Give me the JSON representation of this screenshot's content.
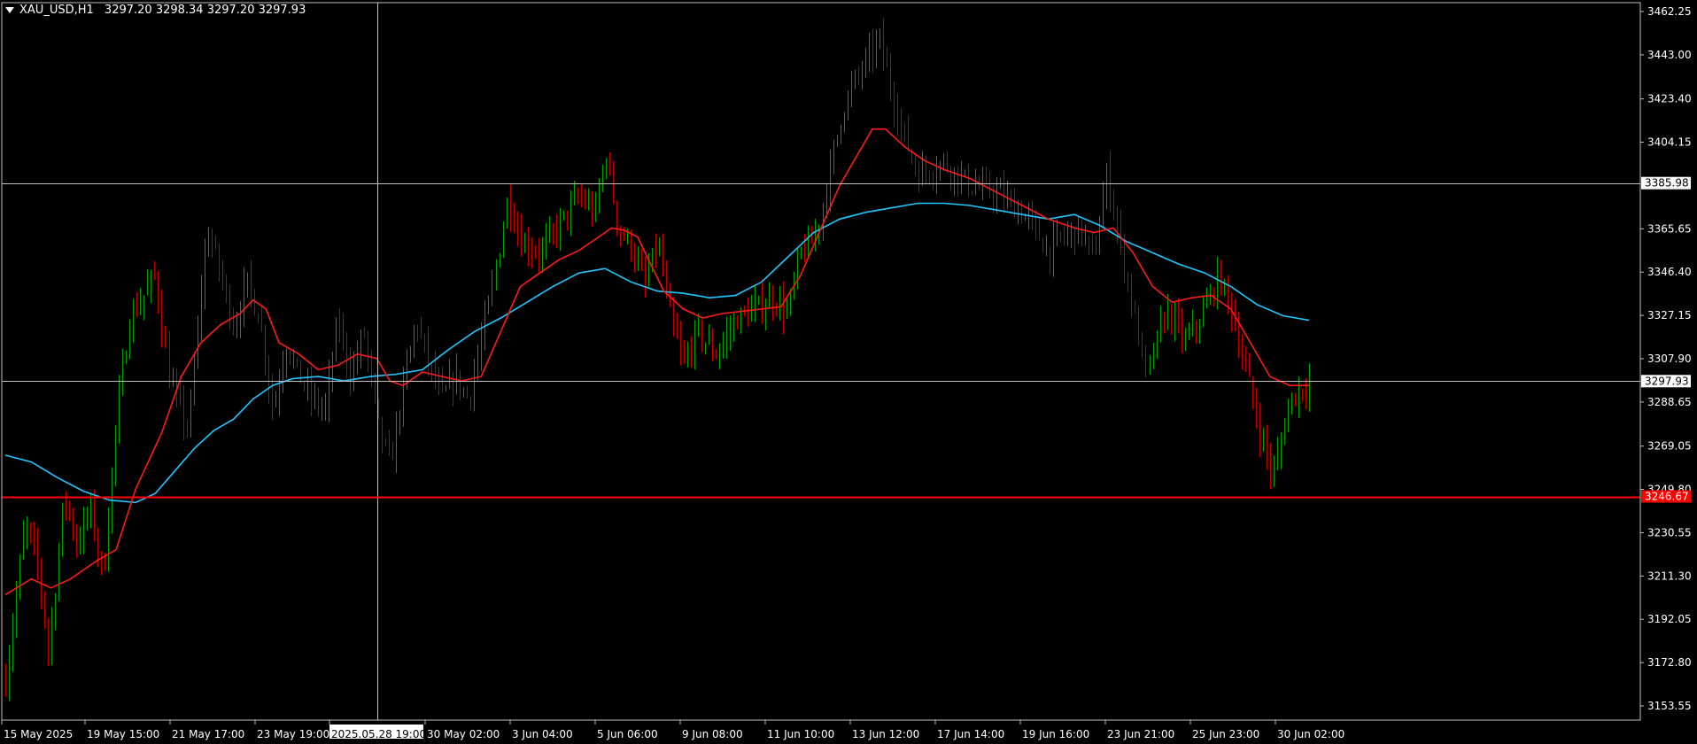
{
  "header": {
    "symbol": "XAU_USD,H1",
    "ohlc": "3297.20 3298.34 3297.20 3297.93"
  },
  "colors": {
    "background": "#000000",
    "frame": "#c0c0c0",
    "bull_bar": "#00a000",
    "bear_bar": "#c00000",
    "ma_fast": "#ff1a1a",
    "ma_slow": "#1ec8ff",
    "hline_red": "#ff0000",
    "hline_gray": "#c0c0c0",
    "crosshair": "#c0c0c0"
  },
  "chart_data": {
    "type": "candlestick",
    "y_ticks": [
      "3462.25",
      "3443.00",
      "3423.40",
      "3404.15",
      "3365.65",
      "3346.40",
      "3327.15",
      "3307.90",
      "3288.65",
      "3269.05",
      "3249.80",
      "3230.55",
      "3211.30",
      "3192.05",
      "3172.80",
      "3153.55"
    ],
    "price_markers": [
      {
        "label": "3385.98",
        "value": 3385.98,
        "style": "gray"
      },
      {
        "label": "3297.93",
        "value": 3297.93,
        "style": "gray"
      },
      {
        "label": "3246.67",
        "value": 3246.67,
        "style": "red"
      }
    ],
    "x_ticks": [
      "15 May 2025",
      "19 May 15:00",
      "21 May 17:00",
      "23 May 19:00",
      "2025.05.28 19:00",
      "30 May 02:00",
      "3 Jun 04:00",
      "5 Jun 06:00",
      "9 Jun 08:00",
      "11 Jun 10:00",
      "13 Jun 12:00",
      "17 Jun 14:00",
      "19 Jun 16:00",
      "23 Jun 21:00",
      "25 Jun 23:00",
      "30 Jun 02:00"
    ],
    "crosshair_label": "2025.05.28 19:00",
    "price_path": [
      [
        0,
        3165
      ],
      [
        0.015,
        3235
      ],
      [
        0.025,
        3215
      ],
      [
        0.033,
        3178
      ],
      [
        0.038,
        3205
      ],
      [
        0.045,
        3248
      ],
      [
        0.055,
        3225
      ],
      [
        0.065,
        3242
      ],
      [
        0.075,
        3210
      ],
      [
        0.085,
        3280
      ],
      [
        0.095,
        3325
      ],
      [
        0.115,
        3345
      ],
      [
        0.125,
        3300
      ],
      [
        0.14,
        3275
      ],
      [
        0.15,
        3340
      ],
      [
        0.155,
        3365
      ],
      [
        0.165,
        3345
      ],
      [
        0.175,
        3322
      ],
      [
        0.185,
        3342
      ],
      [
        0.195,
        3325
      ],
      [
        0.205,
        3285
      ],
      [
        0.215,
        3315
      ],
      [
        0.225,
        3300
      ],
      [
        0.235,
        3290
      ],
      [
        0.245,
        3285
      ],
      [
        0.255,
        3325
      ],
      [
        0.265,
        3300
      ],
      [
        0.275,
        3320
      ],
      [
        0.285,
        3280
      ],
      [
        0.295,
        3260
      ],
      [
        0.305,
        3295
      ],
      [
        0.315,
        3325
      ],
      [
        0.325,
        3305
      ],
      [
        0.335,
        3290
      ],
      [
        0.345,
        3300
      ],
      [
        0.355,
        3290
      ],
      [
        0.365,
        3315
      ],
      [
        0.375,
        3345
      ],
      [
        0.385,
        3380
      ],
      [
        0.395,
        3360
      ],
      [
        0.41,
        3355
      ],
      [
        0.425,
        3368
      ],
      [
        0.44,
        3380
      ],
      [
        0.452,
        3372
      ],
      [
        0.46,
        3400
      ],
      [
        0.47,
        3365
      ],
      [
        0.48,
        3358
      ],
      [
        0.49,
        3340
      ],
      [
        0.5,
        3360
      ],
      [
        0.51,
        3325
      ],
      [
        0.52,
        3305
      ],
      [
        0.53,
        3320
      ],
      [
        0.545,
        3310
      ],
      [
        0.56,
        3325
      ],
      [
        0.575,
        3330
      ],
      [
        0.59,
        3335
      ],
      [
        0.6,
        3328
      ],
      [
        0.61,
        3355
      ],
      [
        0.62,
        3360
      ],
      [
        0.63,
        3385
      ],
      [
        0.64,
        3415
      ],
      [
        0.65,
        3430
      ],
      [
        0.66,
        3440
      ],
      [
        0.67,
        3450
      ],
      [
        0.68,
        3425
      ],
      [
        0.69,
        3405
      ],
      [
        0.7,
        3390
      ],
      [
        0.72,
        3395
      ],
      [
        0.74,
        3385
      ],
      [
        0.76,
        3382
      ],
      [
        0.775,
        3375
      ],
      [
        0.785,
        3370
      ],
      [
        0.8,
        3355
      ],
      [
        0.81,
        3362
      ],
      [
        0.825,
        3365
      ],
      [
        0.835,
        3352
      ],
      [
        0.845,
        3390
      ],
      [
        0.855,
        3360
      ],
      [
        0.865,
        3330
      ],
      [
        0.875,
        3300
      ],
      [
        0.89,
        3330
      ],
      [
        0.905,
        3315
      ],
      [
        0.92,
        3330
      ],
      [
        0.93,
        3345
      ],
      [
        0.94,
        3330
      ],
      [
        0.95,
        3305
      ],
      [
        0.96,
        3280
      ],
      [
        0.972,
        3255
      ],
      [
        0.985,
        3290
      ],
      [
        1.0,
        3297.93
      ]
    ],
    "ma_fast_path": [
      [
        0,
        3203
      ],
      [
        0.02,
        3210
      ],
      [
        0.035,
        3206
      ],
      [
        0.05,
        3210
      ],
      [
        0.07,
        3218
      ],
      [
        0.085,
        3223
      ],
      [
        0.1,
        3250
      ],
      [
        0.12,
        3275
      ],
      [
        0.135,
        3300
      ],
      [
        0.15,
        3315
      ],
      [
        0.165,
        3323
      ],
      [
        0.18,
        3328
      ],
      [
        0.19,
        3334
      ],
      [
        0.2,
        3330
      ],
      [
        0.21,
        3315
      ],
      [
        0.225,
        3310
      ],
      [
        0.24,
        3303
      ],
      [
        0.255,
        3305
      ],
      [
        0.27,
        3310
      ],
      [
        0.285,
        3308
      ],
      [
        0.295,
        3298
      ],
      [
        0.305,
        3296
      ],
      [
        0.32,
        3302
      ],
      [
        0.335,
        3300
      ],
      [
        0.35,
        3298
      ],
      [
        0.365,
        3300
      ],
      [
        0.38,
        3320
      ],
      [
        0.395,
        3340
      ],
      [
        0.41,
        3346
      ],
      [
        0.425,
        3352
      ],
      [
        0.44,
        3356
      ],
      [
        0.455,
        3362
      ],
      [
        0.465,
        3366
      ],
      [
        0.475,
        3365
      ],
      [
        0.485,
        3362
      ],
      [
        0.495,
        3350
      ],
      [
        0.505,
        3338
      ],
      [
        0.52,
        3330
      ],
      [
        0.535,
        3326
      ],
      [
        0.55,
        3328
      ],
      [
        0.565,
        3329
      ],
      [
        0.58,
        3330
      ],
      [
        0.595,
        3331
      ],
      [
        0.61,
        3345
      ],
      [
        0.625,
        3365
      ],
      [
        0.64,
        3385
      ],
      [
        0.655,
        3400
      ],
      [
        0.665,
        3410
      ],
      [
        0.675,
        3410
      ],
      [
        0.69,
        3402
      ],
      [
        0.705,
        3396
      ],
      [
        0.72,
        3392
      ],
      [
        0.74,
        3388
      ],
      [
        0.76,
        3382
      ],
      [
        0.78,
        3376
      ],
      [
        0.8,
        3370
      ],
      [
        0.82,
        3366
      ],
      [
        0.835,
        3364
      ],
      [
        0.85,
        3366
      ],
      [
        0.865,
        3355
      ],
      [
        0.88,
        3340
      ],
      [
        0.895,
        3333
      ],
      [
        0.91,
        3335
      ],
      [
        0.925,
        3336
      ],
      [
        0.94,
        3330
      ],
      [
        0.955,
        3315
      ],
      [
        0.97,
        3300
      ],
      [
        0.985,
        3296
      ],
      [
        1.0,
        3296
      ]
    ],
    "ma_slow_path": [
      [
        0,
        3265
      ],
      [
        0.02,
        3262
      ],
      [
        0.04,
        3255
      ],
      [
        0.06,
        3249
      ],
      [
        0.08,
        3245
      ],
      [
        0.1,
        3244
      ],
      [
        0.115,
        3248
      ],
      [
        0.13,
        3258
      ],
      [
        0.145,
        3268
      ],
      [
        0.16,
        3276
      ],
      [
        0.175,
        3281
      ],
      [
        0.19,
        3290
      ],
      [
        0.205,
        3296
      ],
      [
        0.22,
        3299
      ],
      [
        0.24,
        3300
      ],
      [
        0.26,
        3298
      ],
      [
        0.28,
        3300
      ],
      [
        0.3,
        3301
      ],
      [
        0.32,
        3303
      ],
      [
        0.34,
        3312
      ],
      [
        0.36,
        3320
      ],
      [
        0.38,
        3326
      ],
      [
        0.4,
        3333
      ],
      [
        0.42,
        3340
      ],
      [
        0.44,
        3346
      ],
      [
        0.46,
        3348
      ],
      [
        0.48,
        3342
      ],
      [
        0.5,
        3338
      ],
      [
        0.52,
        3337
      ],
      [
        0.54,
        3335
      ],
      [
        0.56,
        3336
      ],
      [
        0.58,
        3342
      ],
      [
        0.6,
        3353
      ],
      [
        0.62,
        3364
      ],
      [
        0.64,
        3370
      ],
      [
        0.66,
        3373
      ],
      [
        0.68,
        3375
      ],
      [
        0.7,
        3377
      ],
      [
        0.72,
        3377
      ],
      [
        0.74,
        3376
      ],
      [
        0.76,
        3374
      ],
      [
        0.78,
        3372
      ],
      [
        0.8,
        3370
      ],
      [
        0.82,
        3372
      ],
      [
        0.84,
        3367
      ],
      [
        0.86,
        3360
      ],
      [
        0.88,
        3355
      ],
      [
        0.9,
        3350
      ],
      [
        0.92,
        3346
      ],
      [
        0.94,
        3340
      ],
      [
        0.96,
        3332
      ],
      [
        0.98,
        3327
      ],
      [
        1.0,
        3325
      ]
    ]
  }
}
